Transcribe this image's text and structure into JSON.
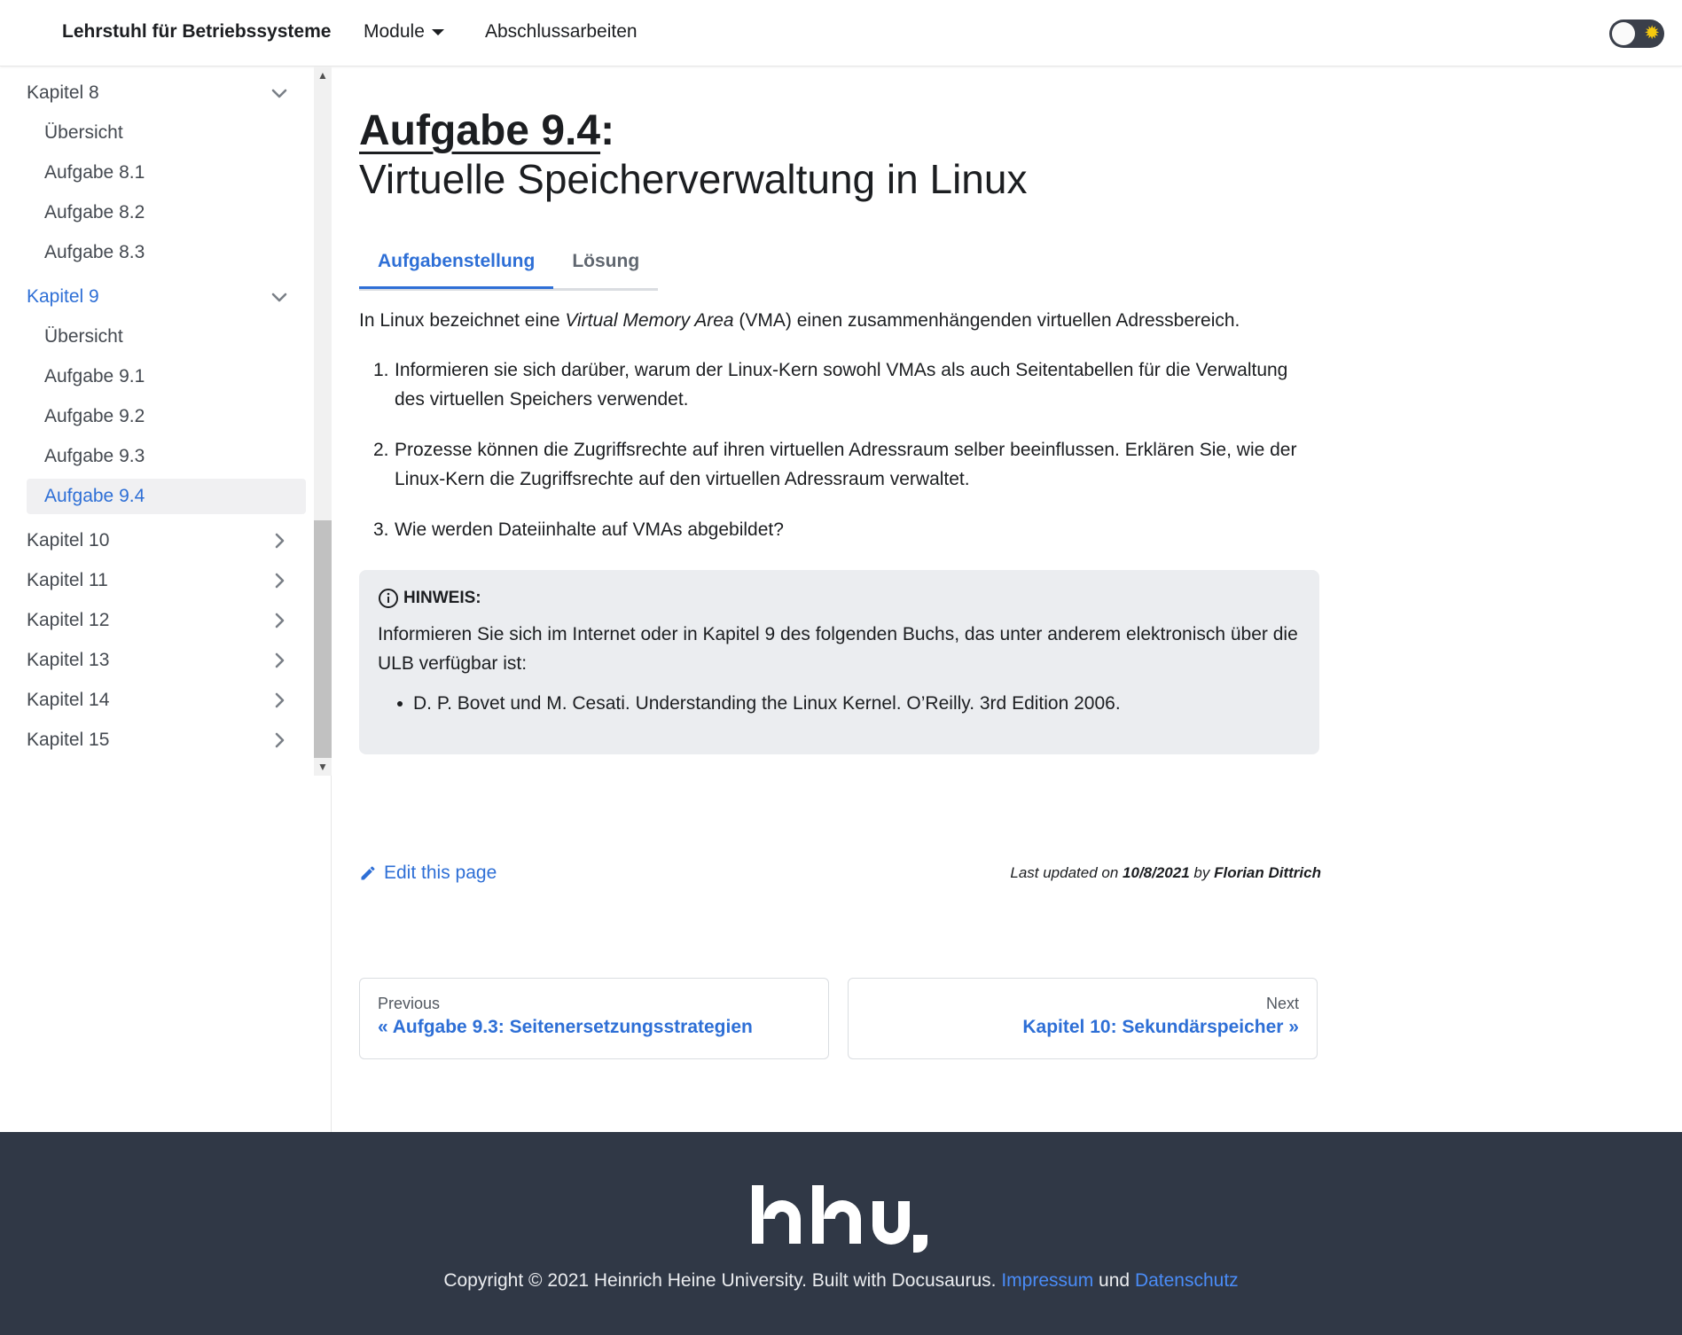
{
  "navbar": {
    "brand": "Lehrstuhl für Betriebssysteme",
    "module": "Module",
    "thesis": "Abschlussarbeiten"
  },
  "sidebar": {
    "items": [
      {
        "label": "Kapitel 8",
        "type": "chapter",
        "expanded": true
      },
      {
        "label": "Übersicht",
        "type": "sub"
      },
      {
        "label": "Aufgabe 8.1",
        "type": "sub"
      },
      {
        "label": "Aufgabe 8.2",
        "type": "sub"
      },
      {
        "label": "Aufgabe 8.3",
        "type": "sub"
      },
      {
        "label": "Kapitel 9",
        "type": "chapter",
        "expanded": true,
        "active": true
      },
      {
        "label": "Übersicht",
        "type": "sub"
      },
      {
        "label": "Aufgabe 9.1",
        "type": "sub"
      },
      {
        "label": "Aufgabe 9.2",
        "type": "sub"
      },
      {
        "label": "Aufgabe 9.3",
        "type": "sub"
      },
      {
        "label": "Aufgabe 9.4",
        "type": "sub",
        "active": true
      },
      {
        "label": "Kapitel 10",
        "type": "chapter",
        "expanded": false
      },
      {
        "label": "Kapitel 11",
        "type": "chapter",
        "expanded": false
      },
      {
        "label": "Kapitel 12",
        "type": "chapter",
        "expanded": false
      },
      {
        "label": "Kapitel 13",
        "type": "chapter",
        "expanded": false
      },
      {
        "label": "Kapitel 14",
        "type": "chapter",
        "expanded": false
      },
      {
        "label": "Kapitel 15",
        "type": "chapter",
        "expanded": false
      }
    ]
  },
  "main": {
    "title_link": "Aufgabe 9.4",
    "title_colon": ":",
    "subtitle": "Virtuelle Speicherverwaltung in Linux",
    "tabs": [
      {
        "label": "Aufgabenstellung",
        "active": true
      },
      {
        "label": "Lösung",
        "active": false
      }
    ],
    "intro_pre": "In Linux bezeichnet eine ",
    "intro_em": "Virtual Memory Area",
    "intro_post": " (VMA) einen zusammenhängenden virtuellen Adressbereich.",
    "list": [
      {
        "num": "1.",
        "text": "Informieren sie sich darüber, warum der Linux-Kern sowohl VMAs als auch Seitentabellen für die Verwaltung des virtuellen Speichers verwendet."
      },
      {
        "num": "2.",
        "text": "Prozesse können die Zugriffsrechte auf ihren virtuellen Adressraum selber beeinflussen. Erklären Sie, wie der Linux-Kern die Zugriffsrechte auf den virtuellen Adressraum verwaltet."
      },
      {
        "num": "3.",
        "text": "Wie werden Dateiinhalte auf VMAs abgebildet?"
      }
    ],
    "hint": {
      "heading": "HINWEIS:",
      "text": "Informieren Sie sich im Internet oder in Kapitel 9 des folgenden Buchs, das unter anderem elektronisch über die ULB verfügbar ist:",
      "bullet": "D. P. Bovet und M. Cesati. Understanding the Linux Kernel. O’Reilly. 3rd Edition 2006."
    },
    "edit": "Edit this page",
    "updated_pre": "Last updated on ",
    "updated_date": "10/8/2021",
    "updated_by": " by ",
    "updated_author": "Florian Dittrich",
    "pager": {
      "prev_sub": "Previous",
      "prev_label": "« Aufgabe 9.3: Seitenersetzungsstrategien",
      "next_sub": "Next",
      "next_label": "Kapitel 10: Sekundärspeicher »"
    }
  },
  "footer": {
    "logo_text": "hhu.",
    "copyright": "Copyright © 2021 Heinrich Heine University. Built with Docusaurus.",
    "impressum": "Impressum",
    "und": "und",
    "datenschutz": "Datenschutz"
  },
  "colors": {
    "accent": "#2e6fd6",
    "footer_bg": "#303846",
    "hint_bg": "#ebedf0"
  }
}
